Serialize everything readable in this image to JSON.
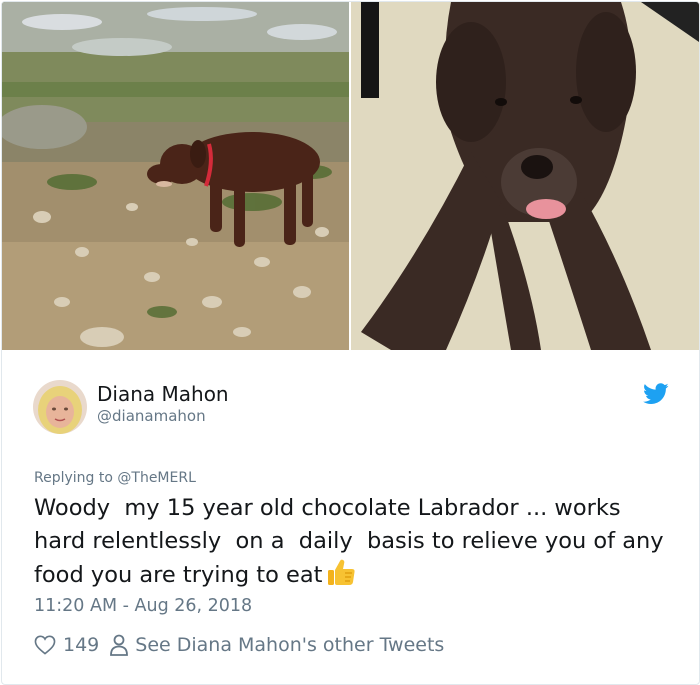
{
  "author": {
    "name": "Diana Mahon",
    "handle": "@dianamahon"
  },
  "reply": {
    "prefix": "Replying to ",
    "to": "@TheMERL"
  },
  "tweet": {
    "text": "Woody  my 15 year old chocolate Labrador ... works hard relentlessly  on a  daily  basis to relieve you of any food you are trying to eat",
    "emoji": "thumbs-up-emoji",
    "timestamp": "11:20 AM - Aug 26, 2018"
  },
  "actions": {
    "likes": "149",
    "other_tweets": "See Diana Mahon's other Tweets"
  },
  "media": {
    "left_image": "chocolate labrador on rocky beach",
    "right_image": "chocolate labrador lying on carpet"
  },
  "colors": {
    "twitter_blue": "#1da1f2",
    "secondary_text": "#657786",
    "primary_text": "#14171a",
    "border": "#e1e8ed"
  }
}
